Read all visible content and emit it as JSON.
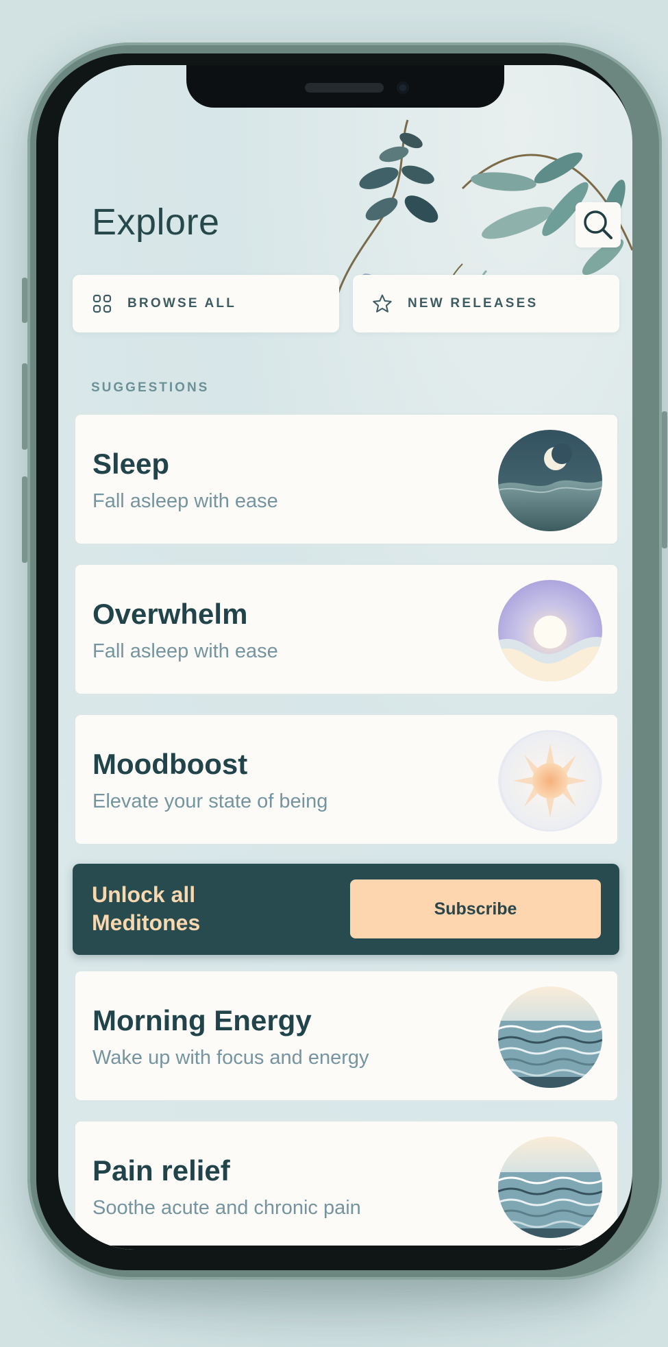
{
  "header": {
    "title": "Explore",
    "search_icon": "search-icon"
  },
  "quick_links": [
    {
      "label": "BROWSE ALL",
      "icon": "grid-icon"
    },
    {
      "label": "NEW RELEASES",
      "icon": "star-icon"
    }
  ],
  "suggestions": {
    "heading": "SUGGESTIONS",
    "items": [
      {
        "title": "Sleep",
        "subtitle": "Fall asleep with ease",
        "art": "moon-over-water"
      },
      {
        "title": "Overwhelm",
        "subtitle": "Fall asleep with ease",
        "art": "sun-on-horizon"
      },
      {
        "title": "Moodboost",
        "subtitle": "Elevate your state of being",
        "art": "sunburst"
      }
    ]
  },
  "promo": {
    "title": "Unlock all Meditones",
    "button_label": "Subscribe"
  },
  "more_items": [
    {
      "title": "Morning Energy",
      "subtitle": "Wake up with focus and energy",
      "art": "waves"
    },
    {
      "title": "Pain relief",
      "subtitle": "Soothe acute and chronic pain",
      "art": "waves"
    }
  ],
  "colors": {
    "accent_dark": "#274b4f",
    "accent_peach": "#fdd6b0",
    "card_bg": "#fdfbf8",
    "title_text": "#21444a",
    "subtitle_text": "#7494a0"
  }
}
